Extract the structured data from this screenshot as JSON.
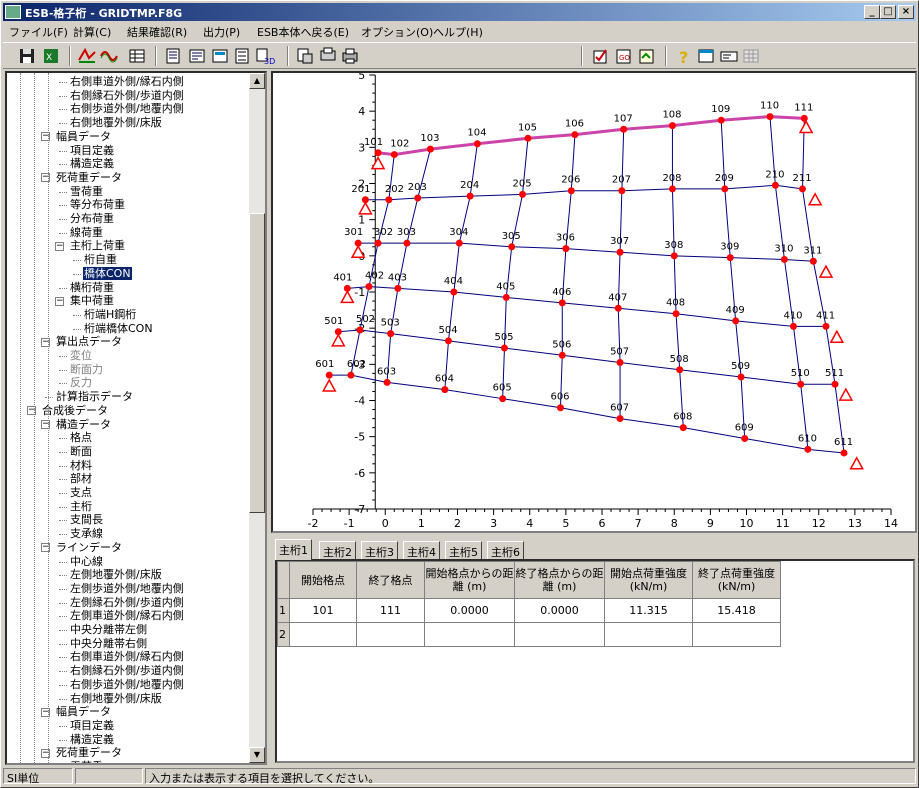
{
  "window": {
    "title": "ESB-格子桁 - GRIDTMP.F8G"
  },
  "menu": [
    "ファイル(F)",
    "計算(C)",
    "結果確認(R)",
    "出力(P)",
    "ESB本体へ戻る(E)",
    "オプション(O)",
    "ヘルプ(H)"
  ],
  "tree": [
    {
      "t": "右側車道外側/縁石内側",
      "l": 4
    },
    {
      "t": "右側縁石外側/歩道内側",
      "l": 4
    },
    {
      "t": "右側歩道外側/地覆内側",
      "l": 4
    },
    {
      "t": "右側地覆外側/床版",
      "l": 4
    },
    {
      "t": "幅員データ",
      "l": 3,
      "e": "-"
    },
    {
      "t": "項目定義",
      "l": 4
    },
    {
      "t": "構造定義",
      "l": 4
    },
    {
      "t": "死荷重データ",
      "l": 3,
      "e": "-"
    },
    {
      "t": "雪荷重",
      "l": 4
    },
    {
      "t": "等分布荷重",
      "l": 4
    },
    {
      "t": "分布荷重",
      "l": 4
    },
    {
      "t": "線荷重",
      "l": 4
    },
    {
      "t": "主桁上荷重",
      "l": 4,
      "e": "-"
    },
    {
      "t": "桁自重",
      "l": 5
    },
    {
      "t": "橋体CON",
      "l": 5,
      "sel": true
    },
    {
      "t": "横桁荷重",
      "l": 4
    },
    {
      "t": "集中荷重",
      "l": 4,
      "e": "-"
    },
    {
      "t": "桁端H鋼桁",
      "l": 5
    },
    {
      "t": "桁端橋体CON",
      "l": 5
    },
    {
      "t": "算出点データ",
      "l": 3,
      "e": "-"
    },
    {
      "t": "変位",
      "l": 4,
      "dis": true
    },
    {
      "t": "断面力",
      "l": 4,
      "dis": true
    },
    {
      "t": "反力",
      "l": 4,
      "dis": true
    },
    {
      "t": "計算指示データ",
      "l": 3
    },
    {
      "t": "合成後データ",
      "l": 2,
      "e": "-"
    },
    {
      "t": "構造データ",
      "l": 3,
      "e": "-"
    },
    {
      "t": "格点",
      "l": 4
    },
    {
      "t": "断面",
      "l": 4
    },
    {
      "t": "材料",
      "l": 4
    },
    {
      "t": "部材",
      "l": 4
    },
    {
      "t": "支点",
      "l": 4
    },
    {
      "t": "主桁",
      "l": 4
    },
    {
      "t": "支間長",
      "l": 4
    },
    {
      "t": "支承線",
      "l": 4
    },
    {
      "t": "ラインデータ",
      "l": 3,
      "e": "-"
    },
    {
      "t": "中心線",
      "l": 4
    },
    {
      "t": "左側地覆外側/床版",
      "l": 4
    },
    {
      "t": "左側歩道外側/地覆内側",
      "l": 4
    },
    {
      "t": "左側縁石外側/歩道内側",
      "l": 4
    },
    {
      "t": "左側車道外側/縁石内側",
      "l": 4
    },
    {
      "t": "中央分離帯左側",
      "l": 4
    },
    {
      "t": "中央分離帯右側",
      "l": 4
    },
    {
      "t": "右側車道外側/縁石内側",
      "l": 4
    },
    {
      "t": "右側縁石外側/歩道内側",
      "l": 4
    },
    {
      "t": "右側歩道外側/地覆内側",
      "l": 4
    },
    {
      "t": "右側地覆外側/床版",
      "l": 4
    },
    {
      "t": "幅員データ",
      "l": 3,
      "e": "-"
    },
    {
      "t": "項目定義",
      "l": 4
    },
    {
      "t": "構造定義",
      "l": 4
    },
    {
      "t": "死荷重データ",
      "l": 3,
      "e": "-"
    },
    {
      "t": "雪荷重",
      "l": 4
    }
  ],
  "chart_data": {
    "type": "scatter",
    "xticks": [
      "-2",
      "-1",
      "0",
      "1",
      "2",
      "3",
      "4",
      "5",
      "6",
      "7",
      "8",
      "9",
      "10",
      "11",
      "12",
      "13",
      "14"
    ],
    "yticks": [
      "5",
      "4",
      "3",
      "2",
      "1",
      "0",
      "-1",
      "-2",
      "-3",
      "-4",
      "-5",
      "-6",
      "-7"
    ],
    "xlim": [
      -2,
      14
    ],
    "ylim": [
      -7,
      5
    ],
    "highlight_color": "#cc44aa",
    "line_color": "#000080",
    "node_color": "#ff0000",
    "rows": [
      {
        "labels": [
          "101",
          "102",
          "103",
          "104",
          "105",
          "106",
          "107",
          "108",
          "109",
          "110",
          "111"
        ],
        "x": [
          -0.2,
          0.25,
          1.25,
          2.55,
          3.95,
          5.25,
          6.6,
          7.95,
          9.3,
          10.65,
          11.6
        ],
        "y": [
          2.85,
          2.8,
          2.95,
          3.1,
          3.25,
          3.35,
          3.5,
          3.6,
          3.75,
          3.85,
          3.8
        ]
      },
      {
        "labels": [
          "201",
          "202",
          "203",
          "204",
          "205",
          "206",
          "207",
          "208",
          "209",
          "210",
          "211"
        ],
        "x": [
          -0.55,
          0.1,
          0.9,
          2.35,
          3.8,
          5.15,
          6.55,
          7.95,
          9.4,
          10.8,
          11.55
        ],
        "y": [
          1.55,
          1.55,
          1.6,
          1.65,
          1.7,
          1.8,
          1.8,
          1.85,
          1.85,
          1.95,
          1.85
        ]
      },
      {
        "labels": [
          "301",
          "302",
          "303",
          "304",
          "305",
          "306",
          "307",
          "308",
          "309",
          "310",
          "311"
        ],
        "x": [
          -0.75,
          -0.2,
          0.6,
          2.05,
          3.5,
          5.0,
          6.5,
          8.0,
          9.55,
          11.05,
          11.85
        ],
        "y": [
          0.35,
          0.35,
          0.35,
          0.35,
          0.25,
          0.2,
          0.1,
          0.0,
          -0.05,
          -0.1,
          -0.15
        ]
      },
      {
        "labels": [
          "401",
          "402",
          "403",
          "404",
          "405",
          "406",
          "407",
          "408",
          "409",
          "410",
          "411"
        ],
        "x": [
          -1.05,
          -0.45,
          0.35,
          1.9,
          3.35,
          4.9,
          6.45,
          8.05,
          9.7,
          11.3,
          12.2
        ],
        "y": [
          -0.9,
          -0.85,
          -0.9,
          -1.0,
          -1.15,
          -1.3,
          -1.45,
          -1.6,
          -1.8,
          -1.95,
          -1.95
        ]
      },
      {
        "labels": [
          "501",
          "502",
          "503",
          "504",
          "505",
          "506",
          "507",
          "508",
          "509",
          "510",
          "511"
        ],
        "x": [
          -1.3,
          -0.7,
          0.15,
          1.75,
          3.3,
          4.9,
          6.5,
          8.15,
          9.85,
          11.5,
          12.45
        ],
        "y": [
          -2.1,
          -2.05,
          -2.15,
          -2.35,
          -2.55,
          -2.75,
          -2.95,
          -3.15,
          -3.35,
          -3.55,
          -3.55
        ]
      },
      {
        "labels": [
          "601",
          "602",
          "603",
          "604",
          "605",
          "606",
          "607",
          "608",
          "609",
          "610",
          "611"
        ],
        "x": [
          -1.55,
          -0.95,
          0.05,
          1.65,
          3.25,
          4.85,
          6.5,
          8.25,
          9.95,
          11.7,
          12.7
        ],
        "y": [
          -3.3,
          -3.3,
          -3.5,
          -3.7,
          -3.95,
          -4.2,
          -4.5,
          -4.75,
          -5.05,
          -5.35,
          -5.45
        ]
      }
    ],
    "supports": [
      {
        "x": -0.2,
        "y": 2.55
      },
      {
        "x": 11.65,
        "y": 3.55
      },
      {
        "x": -0.55,
        "y": 1.3
      },
      {
        "x": 11.9,
        "y": 1.55
      },
      {
        "x": -0.75,
        "y": 0.1
      },
      {
        "x": 12.2,
        "y": -0.45
      },
      {
        "x": -1.05,
        "y": -1.15
      },
      {
        "x": 12.5,
        "y": -2.25
      },
      {
        "x": -1.3,
        "y": -2.35
      },
      {
        "x": 12.75,
        "y": -3.85
      },
      {
        "x": -1.55,
        "y": -3.6
      },
      {
        "x": 13.05,
        "y": -5.75
      }
    ]
  },
  "tabs": [
    "主桁1",
    "主桁2",
    "主桁3",
    "主桁4",
    "主桁5",
    "主桁6"
  ],
  "table": {
    "headers": [
      "開始格点",
      "終了格点",
      "開始格点からの距離 (m)",
      "終了格点からの距離 (m)",
      "開始点荷重強度 (kN/m)",
      "終了点荷重強度 (kN/m)"
    ],
    "rows": [
      [
        "1",
        "101",
        "111",
        "0.0000",
        "0.0000",
        "11.315",
        "15.418"
      ],
      [
        "2",
        "",
        "",
        "",
        "",
        "",
        ""
      ]
    ]
  },
  "status": {
    "units": "SI単位",
    "empty": "",
    "message": "入力または表示する項目を選択してください。"
  }
}
